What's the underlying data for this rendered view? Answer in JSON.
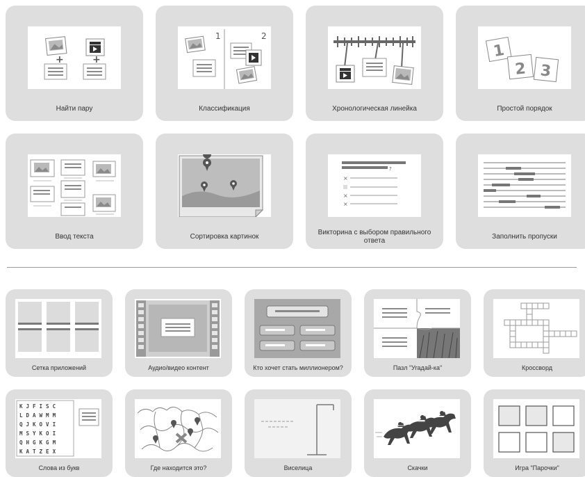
{
  "templates_top": [
    {
      "label": "Найти пару",
      "icon": "match-pairs-icon"
    },
    {
      "label": "Классификация",
      "icon": "classification-icon"
    },
    {
      "label": "Хронологическая линейка",
      "icon": "timeline-icon"
    },
    {
      "label": "Простой порядок",
      "icon": "simple-order-icon"
    },
    {
      "label": "Ввод текста",
      "icon": "text-input-icon"
    },
    {
      "label": "Сортировка картинок",
      "icon": "image-sort-icon"
    },
    {
      "label": "Викторина с выбором правильного ответа",
      "icon": "multiple-choice-quiz-icon"
    },
    {
      "label": "Заполнить пропуски",
      "icon": "fill-blanks-icon"
    }
  ],
  "templates_bottom": [
    {
      "label": "Сетка приложений",
      "icon": "app-grid-icon"
    },
    {
      "label": "Аудио/видео контент",
      "icon": "audio-video-icon"
    },
    {
      "label": "Кто хочет стать миллионером?",
      "icon": "millionaire-icon"
    },
    {
      "label": "Пазл \"Угадай-ка\"",
      "icon": "puzzle-icon"
    },
    {
      "label": "Кроссворд",
      "icon": "crossword-icon"
    },
    {
      "label": "Слова из букв",
      "icon": "word-grid-icon"
    },
    {
      "label": "Где находится это?",
      "icon": "map-pins-icon"
    },
    {
      "label": "Виселица",
      "icon": "hangman-icon"
    },
    {
      "label": "Скачки",
      "icon": "horse-race-icon"
    },
    {
      "label": "Игра \"Парочки\"",
      "icon": "memory-pairs-icon"
    }
  ],
  "thumb_text": {
    "classification_numbers": [
      "1",
      "2"
    ],
    "order_numbers": [
      "1",
      "2",
      "3"
    ],
    "word_grid_rows": [
      "KJFISC",
      "LDAWMM",
      "QJKOVI",
      "MSYKOI",
      "QHGKGM",
      "KATZEX"
    ]
  },
  "colors": {
    "tile": "#dedede",
    "thumb": "#ffffff",
    "divider": "#9a9a9a",
    "icon_gray": "#8c8c8c",
    "icon_light": "#cfcfcf"
  }
}
